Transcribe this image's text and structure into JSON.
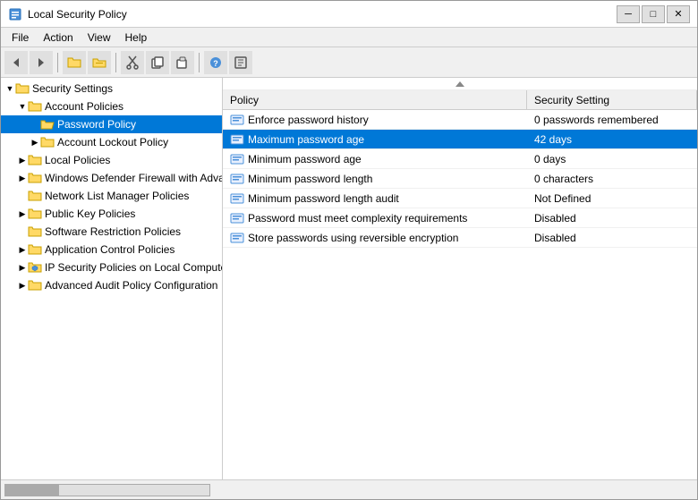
{
  "window": {
    "title": "Local Security Policy",
    "controls": {
      "minimize": "─",
      "maximize": "□",
      "close": "✕"
    }
  },
  "menubar": {
    "items": [
      "File",
      "Action",
      "View",
      "Help"
    ]
  },
  "toolbar": {
    "buttons": [
      {
        "name": "back",
        "icon": "◀"
      },
      {
        "name": "forward",
        "icon": "▶"
      },
      {
        "name": "up",
        "icon": "📁"
      },
      {
        "name": "folder2",
        "icon": "📂"
      },
      {
        "name": "cut",
        "icon": "✂"
      },
      {
        "name": "copy",
        "icon": "⧉"
      },
      {
        "name": "paste",
        "icon": "📋"
      },
      {
        "name": "help",
        "icon": "?"
      },
      {
        "name": "export",
        "icon": "⊞"
      }
    ]
  },
  "tree": {
    "items": [
      {
        "id": "security-settings",
        "label": "Security Settings",
        "indent": 0,
        "expanded": true,
        "hasArrow": true,
        "arrowDown": true,
        "icon": "folder"
      },
      {
        "id": "account-policies",
        "label": "Account Policies",
        "indent": 1,
        "expanded": true,
        "hasArrow": true,
        "arrowDown": true,
        "icon": "folder"
      },
      {
        "id": "password-policy",
        "label": "Password Policy",
        "indent": 2,
        "expanded": false,
        "hasArrow": false,
        "selected": true,
        "icon": "folder-open"
      },
      {
        "id": "account-lockout",
        "label": "Account Lockout Policy",
        "indent": 2,
        "expanded": false,
        "hasArrow": true,
        "arrowDown": false,
        "icon": "folder"
      },
      {
        "id": "local-policies",
        "label": "Local Policies",
        "indent": 1,
        "expanded": false,
        "hasArrow": true,
        "arrowDown": false,
        "icon": "folder"
      },
      {
        "id": "windows-firewall",
        "label": "Windows Defender Firewall with Adva...",
        "indent": 1,
        "expanded": false,
        "hasArrow": true,
        "arrowDown": false,
        "icon": "folder"
      },
      {
        "id": "network-list",
        "label": "Network List Manager Policies",
        "indent": 1,
        "expanded": false,
        "hasArrow": false,
        "icon": "folder"
      },
      {
        "id": "public-key",
        "label": "Public Key Policies",
        "indent": 1,
        "expanded": false,
        "hasArrow": true,
        "arrowDown": false,
        "icon": "folder"
      },
      {
        "id": "software-restriction",
        "label": "Software Restriction Policies",
        "indent": 1,
        "expanded": false,
        "hasArrow": false,
        "icon": "folder"
      },
      {
        "id": "application-control",
        "label": "Application Control Policies",
        "indent": 1,
        "expanded": false,
        "hasArrow": true,
        "arrowDown": false,
        "icon": "folder"
      },
      {
        "id": "ip-security",
        "label": "IP Security Policies on Local Compute...",
        "indent": 1,
        "expanded": false,
        "hasArrow": true,
        "arrowDown": false,
        "icon": "folder-shield"
      },
      {
        "id": "advanced-audit",
        "label": "Advanced Audit Policy Configuration",
        "indent": 1,
        "expanded": false,
        "hasArrow": true,
        "arrowDown": false,
        "icon": "folder"
      }
    ]
  },
  "list": {
    "columns": [
      {
        "id": "policy",
        "label": "Policy"
      },
      {
        "id": "setting",
        "label": "Security Setting"
      }
    ],
    "rows": [
      {
        "id": "enforce-history",
        "policy": "Enforce password history",
        "setting": "0 passwords remembered",
        "selected": false
      },
      {
        "id": "max-age",
        "policy": "Maximum password age",
        "setting": "42 days",
        "selected": true
      },
      {
        "id": "min-age",
        "policy": "Minimum password age",
        "setting": "0 days",
        "selected": false
      },
      {
        "id": "min-length",
        "policy": "Minimum password length",
        "setting": "0 characters",
        "selected": false
      },
      {
        "id": "min-length-audit",
        "policy": "Minimum password length audit",
        "setting": "Not Defined",
        "selected": false
      },
      {
        "id": "complexity",
        "policy": "Password must meet complexity requirements",
        "setting": "Disabled",
        "selected": false
      },
      {
        "id": "reversible",
        "policy": "Store passwords using reversible encryption",
        "setting": "Disabled",
        "selected": false
      }
    ]
  }
}
